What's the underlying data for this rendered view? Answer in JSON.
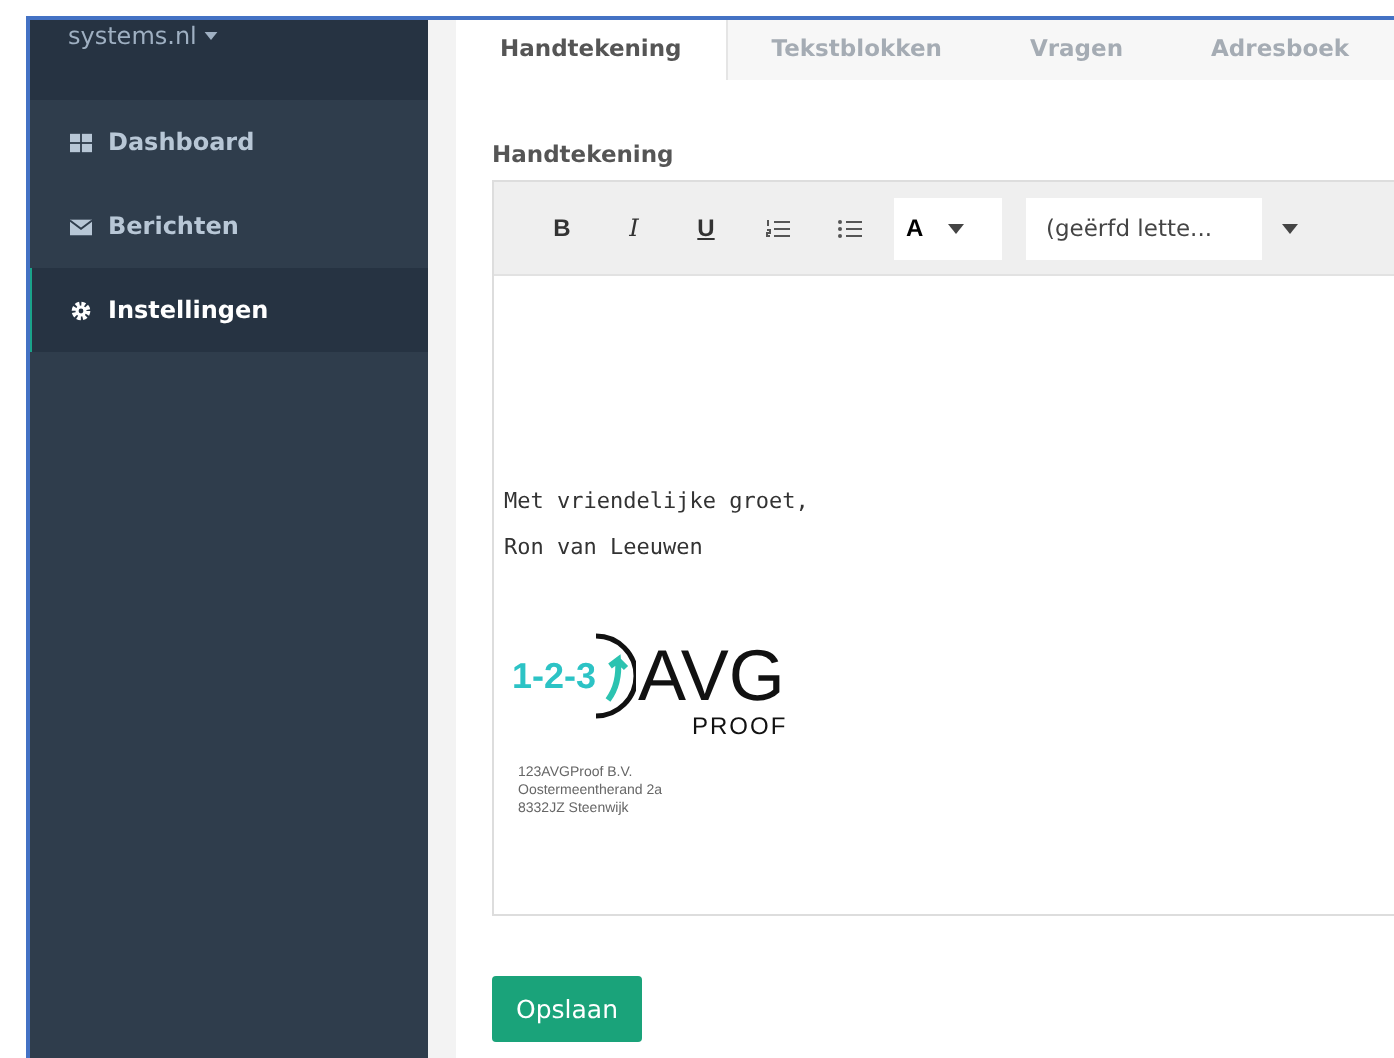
{
  "sidebar": {
    "brand": "systems.nl",
    "items": [
      {
        "label": "Dashboard",
        "selected": false
      },
      {
        "label": "Berichten",
        "selected": false
      },
      {
        "label": "Instellingen",
        "selected": true
      }
    ]
  },
  "tabs": [
    {
      "label": "Handtekening",
      "selected": true
    },
    {
      "label": "Tekstblokken",
      "selected": false
    },
    {
      "label": "Vragen",
      "selected": false
    },
    {
      "label": "Adresboek",
      "selected": false
    }
  ],
  "section_label": "Handtekening",
  "toolbar": {
    "buttons": [
      {
        "label": "B",
        "kind": "bold"
      },
      {
        "label": "I",
        "kind": "italic"
      },
      {
        "label": "U",
        "kind": "underline"
      },
      {
        "kind": "ordered-list"
      },
      {
        "kind": "bullet-list"
      }
    ],
    "color_label": "A",
    "font_select": "(geërfd lette..."
  },
  "editor": {
    "lines": [
      "Met vriendelijke groet,",
      "Ron van Leeuwen"
    ],
    "logo": {
      "number": "1-2-3",
      "name": "AVG",
      "subtitle": "PROOF"
    },
    "address": [
      "123AVGProof B.V.",
      "Oostermeentherand 2a",
      "8332JZ  Steenwijk"
    ]
  },
  "save_button": "Opslaan"
}
